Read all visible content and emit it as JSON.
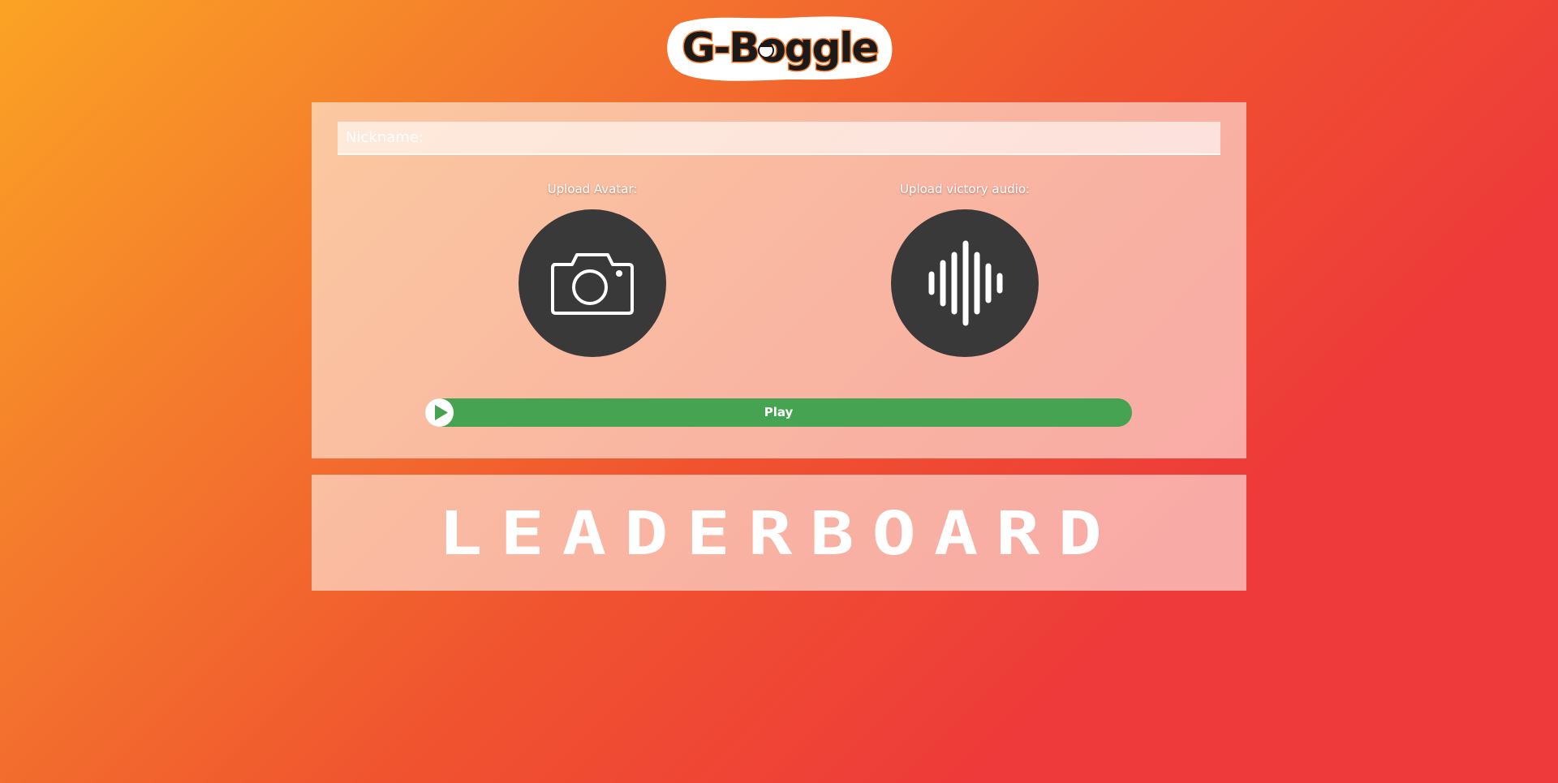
{
  "header": {
    "logo_text": "G-Boggle"
  },
  "form": {
    "nickname_placeholder": "Nickname:",
    "nickname_value": "",
    "upload_avatar_label": "Upload Avatar:",
    "upload_audio_label": "Upload victory audio:",
    "avatar_icon": "camera-icon",
    "audio_icon": "sound-wave-icon",
    "play_label": "Play",
    "play_icon": "play-icon"
  },
  "leaderboard": {
    "title": "LEADERBOARD"
  },
  "colors": {
    "background_start": "#fba324",
    "background_end": "#ee3a3a",
    "button_circle": "#3a393a",
    "play_button": "#46a351",
    "logo_accent": "#f47a2d"
  }
}
